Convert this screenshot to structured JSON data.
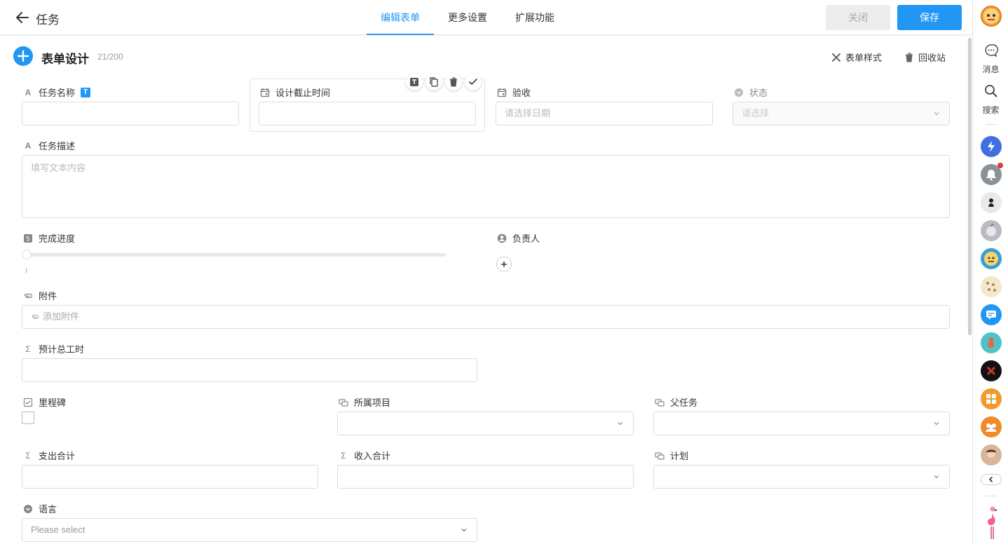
{
  "header": {
    "title": "任务",
    "tabs": [
      {
        "label": "编辑表单"
      },
      {
        "label": "更多设置"
      },
      {
        "label": "扩展功能"
      }
    ],
    "close_label": "关闭",
    "save_label": "保存"
  },
  "sidebar": {
    "messages_label": "消息",
    "search_label": "搜索",
    "app_icons": [
      "spark-app-icon",
      "bell-app-icon",
      "user-app-icon",
      "apple-app-icon",
      "badge-app-icon",
      "dots-app-icon",
      "chat-app-icon",
      "hand-app-icon",
      "cross-app-icon",
      "grid-app-icon",
      "group-app-icon",
      "avatar-app-icon"
    ]
  },
  "form": {
    "title": "表单设计",
    "count": "21/200",
    "style_label": "表单样式",
    "recycle_label": "回收站",
    "fields": {
      "task_name": {
        "label": "任务名称",
        "badge": "T"
      },
      "design_deadline": {
        "label": "设计截止时间"
      },
      "acceptance": {
        "label": "验收",
        "placeholder": "请选择日期"
      },
      "status": {
        "label": "状态",
        "placeholder": "请选择"
      },
      "task_desc": {
        "label": "任务描述",
        "placeholder": "填写文本内容"
      },
      "progress": {
        "label": "完成进度",
        "value": 0
      },
      "owner": {
        "label": "负责人"
      },
      "attachment": {
        "label": "附件",
        "placeholder": "添加附件"
      },
      "est_hours": {
        "label": "预计总工时"
      },
      "milestone": {
        "label": "里程碑"
      },
      "project": {
        "label": "所属项目"
      },
      "parent_task": {
        "label": "父任务"
      },
      "expense": {
        "label": "支出合计"
      },
      "income": {
        "label": "收入合计"
      },
      "plan": {
        "label": "计划"
      },
      "language": {
        "label": "语言",
        "placeholder": "Please select"
      }
    }
  },
  "colors": {
    "accent": "#2196f3",
    "notification": "#e53935"
  }
}
